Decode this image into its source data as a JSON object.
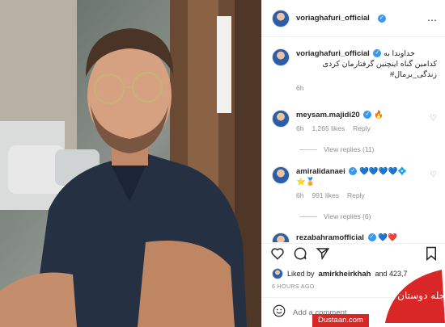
{
  "post": {
    "author": "voriaghafuri_official",
    "caption_lines": [
      "خداوندا به",
      "کدامین گناه اینچنین گرفتارمان کردی",
      "زندگی_برمال#"
    ],
    "caption_time": "6h"
  },
  "comments": [
    {
      "username": "meysam.majidi20",
      "emoji": "🔥",
      "time": "6h",
      "likes": "1,265 likes",
      "reply_label": "Reply",
      "view_replies": "View replies (11)"
    },
    {
      "username": "amiralidanaei",
      "emoji_line1": "💙💙💙💙💠",
      "emoji_line2": "⭐🏅",
      "time": "6h",
      "likes": "991 likes",
      "reply_label": "Reply",
      "view_replies": "View replies (6)"
    },
    {
      "username": "rezabahramofficial",
      "emoji": "💙❤️"
    }
  ],
  "liked_by": {
    "prefix": "Liked by",
    "user": "amirkheirkhah",
    "suffix": "and 423,7"
  },
  "post_time": "6 HOURS AGO",
  "add_comment": {
    "placeholder": "Add a comment..."
  },
  "watermark": {
    "text": "Dustaan.com",
    "logo_text": "مجله دوستان"
  },
  "icons": {
    "more": "more-icon",
    "heart": "heart-icon",
    "comment": "comment-icon",
    "share": "share-icon",
    "save": "save-icon",
    "emoji": "emoji-icon"
  },
  "colors": {
    "verified": "#3897f0",
    "meta": "#8e8e8e",
    "watermark": "#d92626"
  }
}
